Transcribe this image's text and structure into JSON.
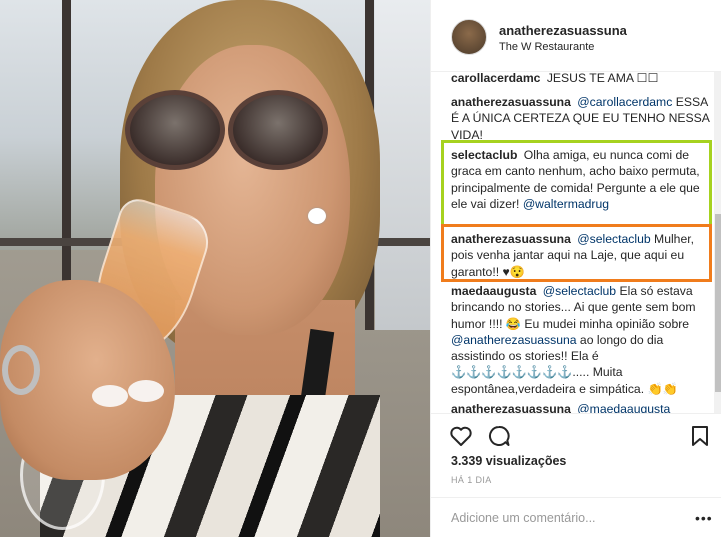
{
  "post": {
    "username": "anatherezasuassuna",
    "location": "The W Restaurante"
  },
  "comments": [
    {
      "user": "carollacerdamc",
      "text": "JESUS TE AMA ☐☐"
    },
    {
      "user": "anatherezasuassuna",
      "mention": "@carollacerdamc",
      "text": "ESSA É A ÚNICA CERTEZA QUE EU TENHO NESSA VIDA!"
    },
    {
      "user": "selectaclub",
      "text": "Olha amiga, eu nunca comi de graca em canto nenhum, acho baixo permuta, principalmente de comida! Pergunte a ele que ele vai dizer!",
      "mention": "@waltermadrug"
    },
    {
      "user": "anatherezasuassuna",
      "mention": "@selectaclub",
      "text": "Mulher, pois venha jantar aqui na Laje, que aqui eu garanto!! ♥😯"
    },
    {
      "user": "maedaaugusta",
      "mention": "@selectaclub",
      "text": "Ela só estava brincando no stories... Ai que gente sem bom humor !!!! 😂 Eu mudei minha opinião sobre",
      "mention2": "@anatherezasuassuna",
      "text2": "ao longo do dia assistindo os stories!! Ela é ⚓⚓⚓⚓⚓⚓⚓⚓..... Muita espontânea,verdadeira e simpática. 👏👏"
    },
    {
      "user": "anatherezasuassuna",
      "mention": "@maedaaugusta",
      "text": ""
    }
  ],
  "highlight_colors": {
    "green": "#a6d21f",
    "orange": "#f07c1c"
  },
  "actions": {
    "icons": [
      "heart-icon",
      "comment-icon",
      "bookmark-icon"
    ],
    "views": "3.339 visualizações",
    "date": "HÁ 1 DIA"
  },
  "add_comment": {
    "placeholder": "Adicione um comentário...",
    "more": "•••"
  }
}
